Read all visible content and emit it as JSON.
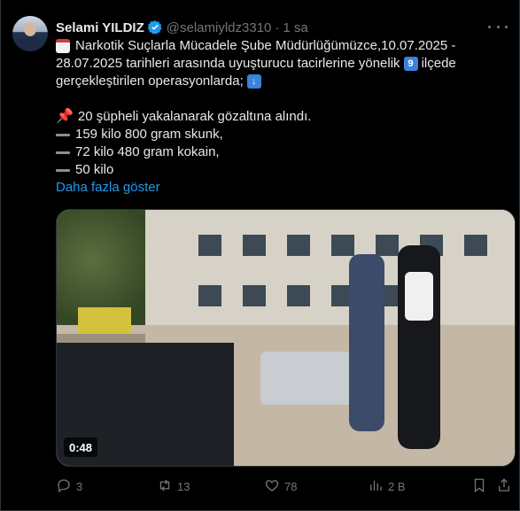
{
  "tweet": {
    "author_name": "Selami YILDIZ",
    "author_handle": "@selamiyldz3310",
    "separator": "·",
    "time": "1 sa",
    "line1": "Narkotik Suçlarla Mücadele Şube Müdürlüğümüzce,10.07.2025 -",
    "line2a": "28.07.2025 tarihleri arasında uyuşturucu tacirlerine yönelik",
    "nine_badge": "9",
    "line2b": "ilçede",
    "line3": "gerçekleştirilen operasyonlarda;",
    "line5": "20 şüpheli yakalanarak gözaltına alındı.",
    "line6": "159 kilo 800 gram skunk,",
    "line7": "72 kilo 480 gram kokain,",
    "line8": "50 kilo",
    "show_more": "Daha fazla göster",
    "video_duration": "0:48"
  },
  "actions": {
    "reply_count": "3",
    "retweet_count": "13",
    "like_count": "78",
    "views_count": "2 B"
  },
  "icons": {
    "verified": "verified-badge-icon",
    "more": "more-icon",
    "calendar": "calendar-icon",
    "pushpin": "pushpin-icon",
    "reply": "reply-icon",
    "retweet": "retweet-icon",
    "like": "heart-icon",
    "views": "views-icon",
    "bookmark": "bookmark-icon",
    "share": "share-icon"
  },
  "colors": {
    "accent": "#1d9bf0",
    "text": "#e7e9ea",
    "muted": "#71767b",
    "background": "#000000"
  }
}
